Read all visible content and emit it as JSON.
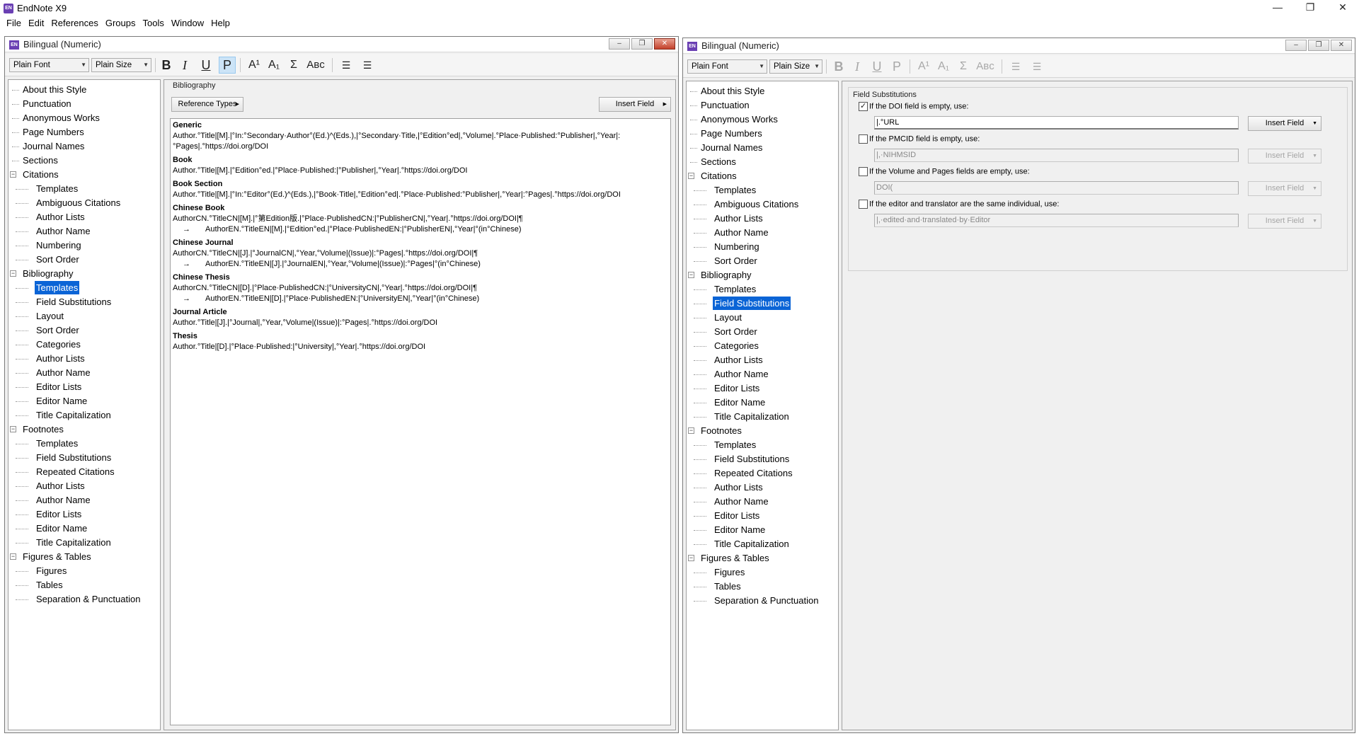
{
  "app": {
    "title": "EndNote X9",
    "icon_text": "EN"
  },
  "window_controls": [
    "minimize-icon",
    "restore-icon",
    "close-icon"
  ],
  "menu": [
    "File",
    "Edit",
    "References",
    "Groups",
    "Tools",
    "Window",
    "Help"
  ],
  "left_window": {
    "title": "Bilingual (Numeric)",
    "font_select": "Plain Font",
    "size_select": "Plain Size",
    "format_buttons": {
      "bold": "B",
      "italic": "I",
      "underline": "U",
      "plain": "P",
      "superscript": "A¹",
      "subscript": "A₁",
      "symbol": "Σ",
      "smallcaps": "Aʙc"
    },
    "tree": [
      {
        "label": "About this Style",
        "level": 0
      },
      {
        "label": "Punctuation",
        "level": 0
      },
      {
        "label": "Anonymous Works",
        "level": 0
      },
      {
        "label": "Page Numbers",
        "level": 0
      },
      {
        "label": "Journal Names",
        "level": 0
      },
      {
        "label": "Sections",
        "level": 0
      },
      {
        "label": "Citations",
        "level": 0,
        "expander": true
      },
      {
        "label": "Templates",
        "level": 1
      },
      {
        "label": "Ambiguous Citations",
        "level": 1
      },
      {
        "label": "Author Lists",
        "level": 1
      },
      {
        "label": "Author Name",
        "level": 1
      },
      {
        "label": "Numbering",
        "level": 1
      },
      {
        "label": "Sort Order",
        "level": 1
      },
      {
        "label": "Bibliography",
        "level": 0,
        "expander": true
      },
      {
        "label": "Templates",
        "level": 1,
        "selected": true
      },
      {
        "label": "Field Substitutions",
        "level": 1
      },
      {
        "label": "Layout",
        "level": 1
      },
      {
        "label": "Sort Order",
        "level": 1
      },
      {
        "label": "Categories",
        "level": 1
      },
      {
        "label": "Author Lists",
        "level": 1
      },
      {
        "label": "Author Name",
        "level": 1
      },
      {
        "label": "Editor Lists",
        "level": 1
      },
      {
        "label": "Editor Name",
        "level": 1
      },
      {
        "label": "Title Capitalization",
        "level": 1
      },
      {
        "label": "Footnotes",
        "level": 0,
        "expander": true
      },
      {
        "label": "Templates",
        "level": 1
      },
      {
        "label": "Field Substitutions",
        "level": 1
      },
      {
        "label": "Repeated Citations",
        "level": 1
      },
      {
        "label": "Author Lists",
        "level": 1
      },
      {
        "label": "Author Name",
        "level": 1
      },
      {
        "label": "Editor Lists",
        "level": 1
      },
      {
        "label": "Editor Name",
        "level": 1
      },
      {
        "label": "Title Capitalization",
        "level": 1
      },
      {
        "label": "Figures & Tables",
        "level": 0,
        "expander": true
      },
      {
        "label": "Figures",
        "level": 1
      },
      {
        "label": "Tables",
        "level": 1
      },
      {
        "label": "Separation & Punctuation",
        "level": 1
      }
    ],
    "content": {
      "group_label": "Bibliography",
      "reference_types_button": "Reference Types",
      "insert_field_button": "Insert Field",
      "templates": [
        {
          "name": "Generic",
          "lines": [
            {
              "text": "Author.°Title|[M].|°In:°Secondary·Author°(Ed.)^(Eds.),|°Secondary·Title,|°Edition°ed|,°Volume|.°Place·Published:°Publisher|,°Year|:",
              "indent": false
            },
            {
              "text": "°Pages|.°https://doi.org/DOI",
              "indent": false
            }
          ]
        },
        {
          "name": "Book",
          "lines": [
            {
              "text": "Author.°Title|[M].|°Edition°ed.|°Place·Published:|°Publisher|,°Year|.°https://doi.org/DOI",
              "indent": false
            }
          ]
        },
        {
          "name": "Book Section",
          "lines": [
            {
              "text": "Author.°Title|[M].|°In:°Editor°(Ed.)^(Eds.),|°Book·Title|,°Edition°ed|.°Place·Published:°Publisher|,°Year|:°Pages|.°https://doi.org/DOI",
              "indent": false
            }
          ]
        },
        {
          "name": "Chinese Book",
          "lines": [
            {
              "text": "AuthorCN.°TitleCN|[M].|°第Edition版.|°Place·PublishedCN:|°PublisherCN|,°Year|.°https://doi.org/DOI|¶",
              "indent": false
            },
            {
              "text": "AuthorEN.°TitleEN|[M].|°Edition°ed.|°Place·PublishedEN:|°PublisherEN|,°Year|°(in°Chinese)",
              "indent": true
            }
          ]
        },
        {
          "name": "Chinese Journal",
          "lines": [
            {
              "text": "AuthorCN.°TitleCN|[J].|°JournalCN|,°Year,°Volume|(Issue)|:°Pages|.°https://doi.org/DOI|¶",
              "indent": false
            },
            {
              "text": "AuthorEN.°TitleEN|[J].|°JournalEN|,°Year,°Volume|(Issue)|:°Pages|°(in°Chinese)",
              "indent": true
            }
          ]
        },
        {
          "name": "Chinese Thesis",
          "lines": [
            {
              "text": "AuthorCN.°TitleCN|[D].|°Place·PublishedCN:|°UniversityCN|,°Year|.°https://doi.org/DOI|¶",
              "indent": false
            },
            {
              "text": "AuthorEN.°TitleEN|[D].|°Place·PublishedEN:|°UniversityEN|,°Year|°(in°Chinese)",
              "indent": true
            }
          ]
        },
        {
          "name": "Journal Article",
          "lines": [
            {
              "text": "Author.°Title|[J].|°Journal|,°Year,°Volume|(Issue)|:°Pages|.°https://doi.org/DOI",
              "indent": false
            }
          ]
        },
        {
          "name": "Thesis",
          "lines": [
            {
              "text": "Author.°Title|[D].|°Place·Published:|°University|,°Year|.°https://doi.org/DOI",
              "indent": false
            }
          ]
        }
      ]
    }
  },
  "right_window": {
    "title": "Bilingual (Numeric)",
    "font_select": "Plain Font",
    "size_select": "Plain Size",
    "tree_selected": "Field Substitutions",
    "content": {
      "group_label": "Field Substitutions",
      "substitutions": [
        {
          "label": "If the DOI field is empty, use:",
          "checked": true,
          "value": "|.°URL",
          "button": "Insert Field",
          "enabled": true
        },
        {
          "label": "If the PMCID field is empty, use:",
          "checked": false,
          "value": "|,·NIHMSID",
          "button": "Insert Field",
          "enabled": false
        },
        {
          "label": "If the Volume and Pages fields are empty, use:",
          "checked": false,
          "value": "DOI(",
          "button": "Insert Field",
          "enabled": false
        },
        {
          "label": "If the editor and translator are the same individual, use:",
          "checked": false,
          "value": "|,·edited·and·translated·by·Editor",
          "button": "Insert Field",
          "enabled": false
        }
      ]
    }
  }
}
